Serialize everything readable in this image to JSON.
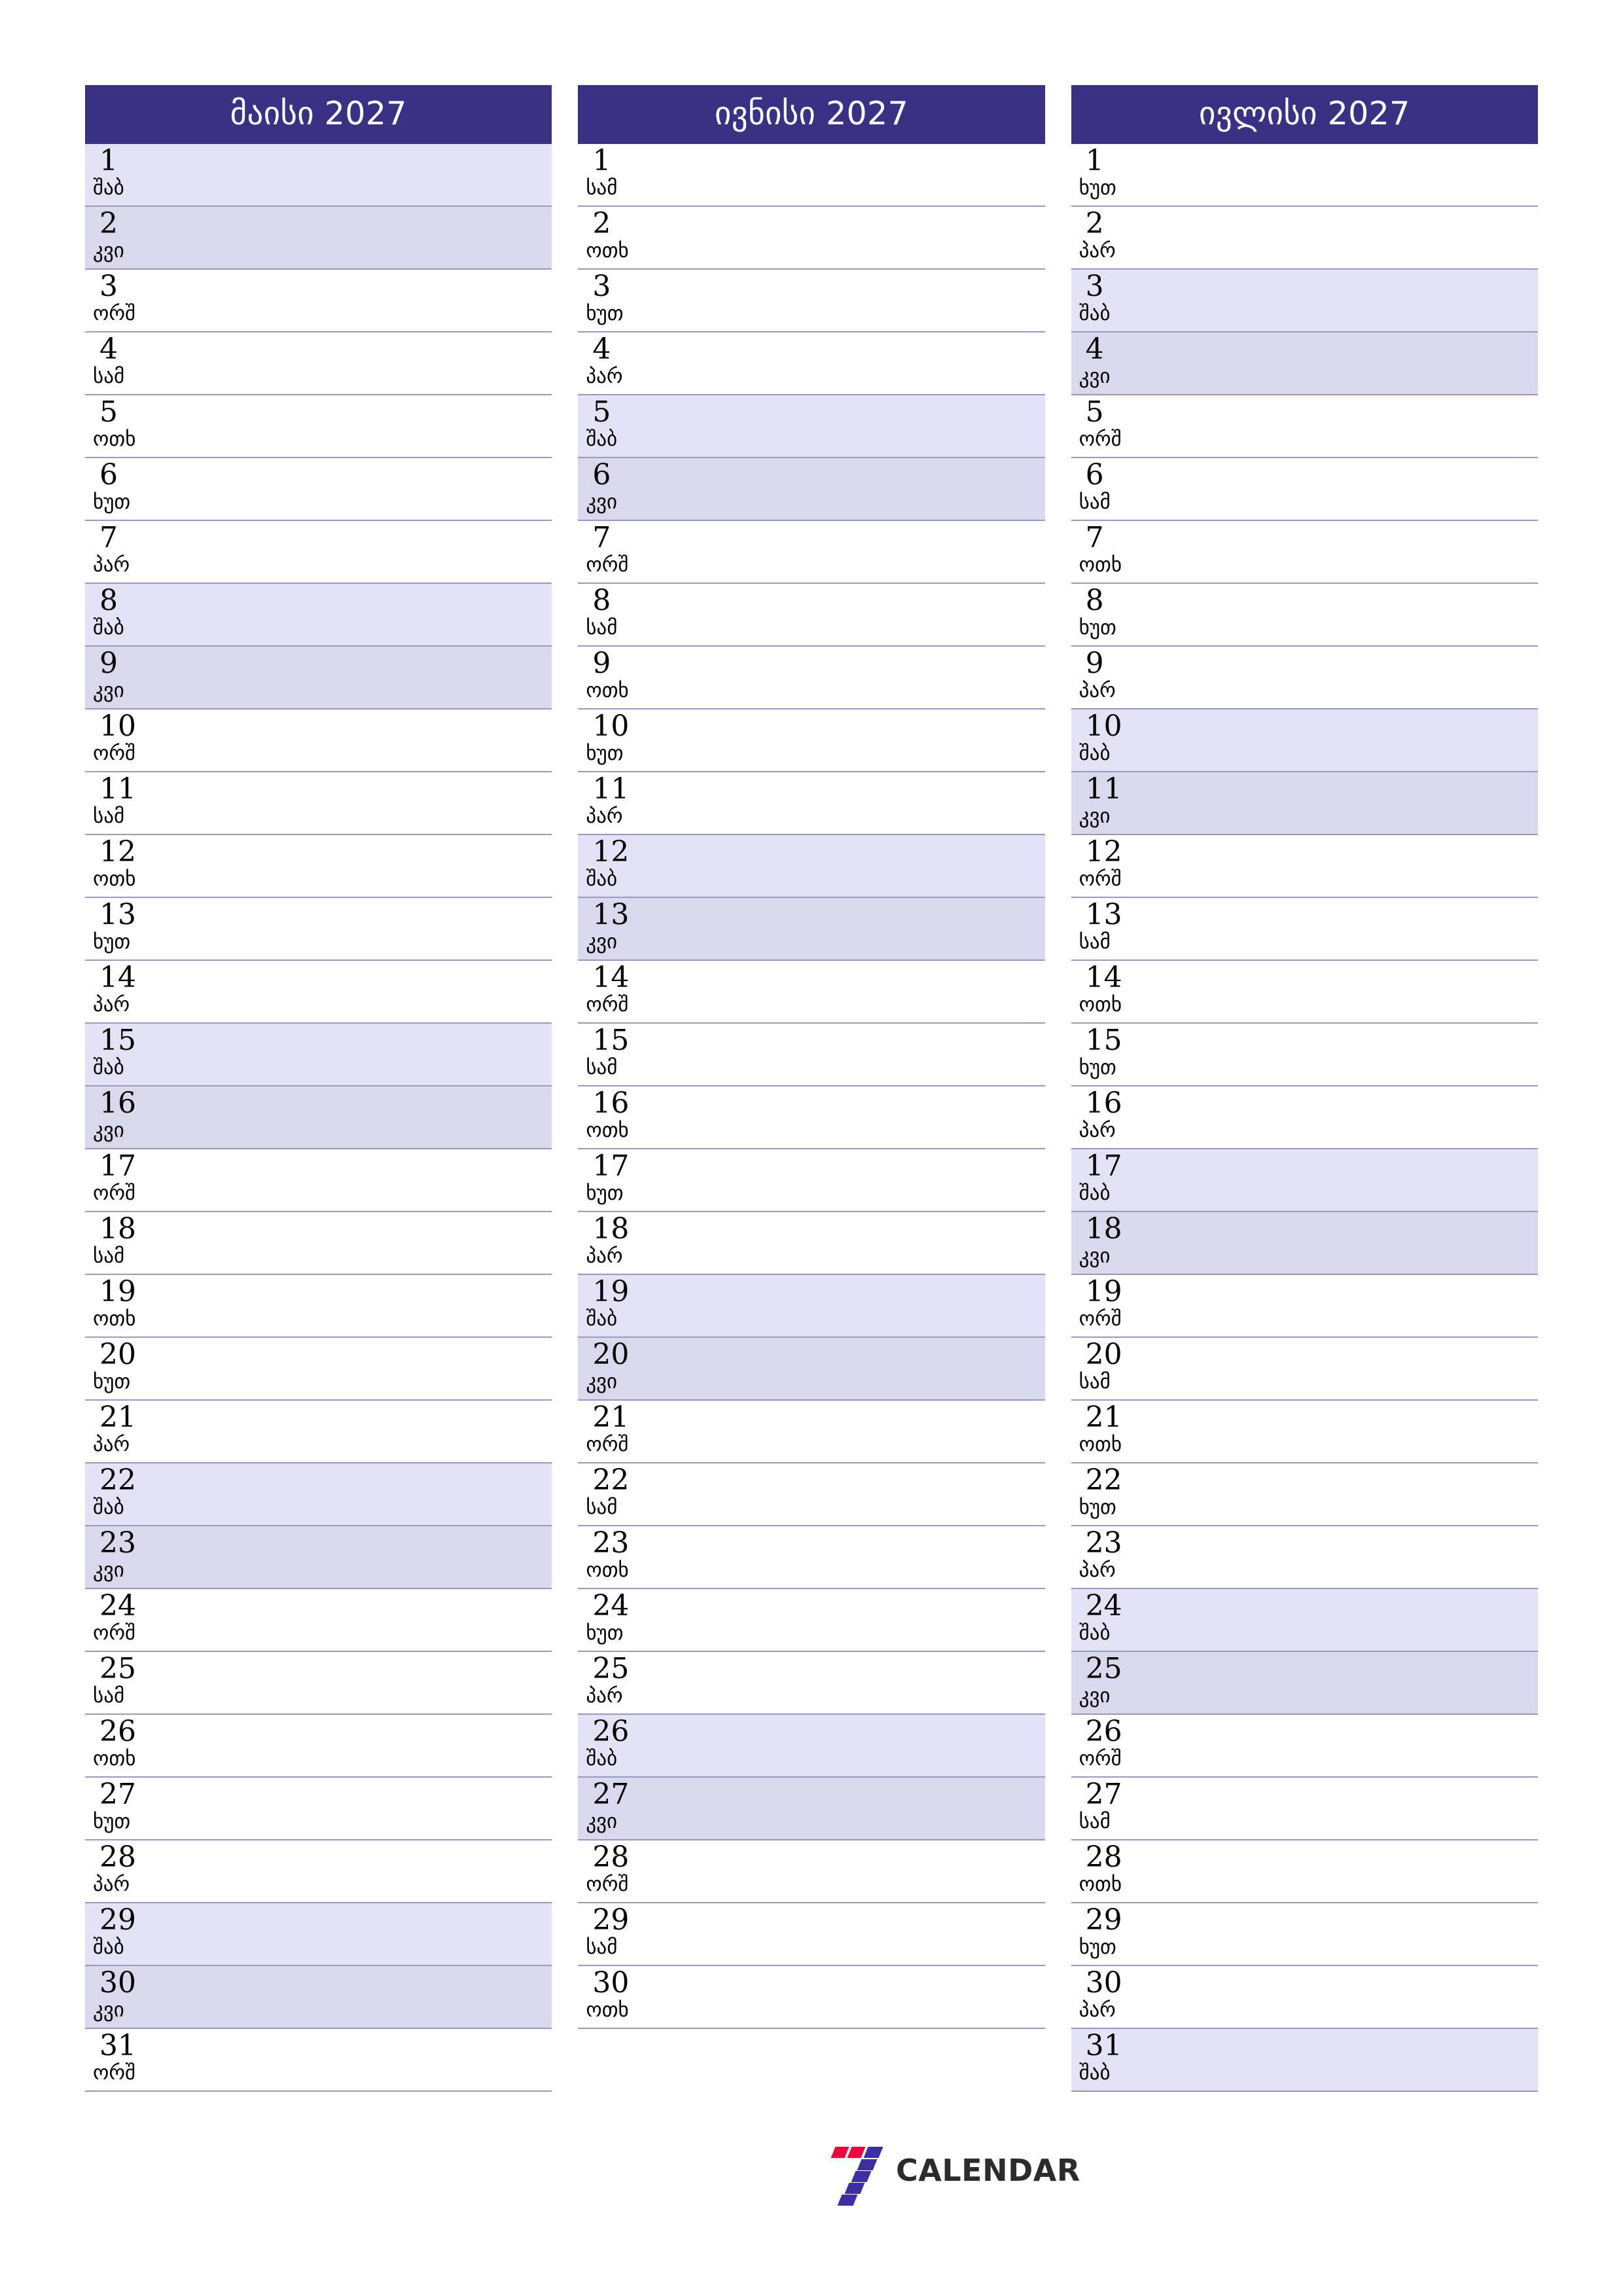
{
  "page": {
    "year": "2027",
    "accent_color": "#3a3185",
    "saturday_color": "#e3e3f5",
    "sunday_color": "#dad8ec",
    "grid_line_color": "#9b96c4"
  },
  "brand": {
    "name": "CALENDAR",
    "mark_colors": [
      "#f4003c",
      "#3d2fa3"
    ]
  },
  "weekday_names": {
    "mon": "ორშ",
    "tue": "სამ",
    "wed": "ოთხ",
    "thu": "ხუთ",
    "fri": "პარ",
    "sat": "შაბ",
    "sun": "კვი"
  },
  "months": [
    {
      "title": "მაისი 2027",
      "name": "მაისი",
      "days": [
        {
          "n": "1",
          "wd": "შაბ",
          "type": "sat"
        },
        {
          "n": "2",
          "wd": "კვი",
          "type": "sun"
        },
        {
          "n": "3",
          "wd": "ორშ",
          "type": "wd"
        },
        {
          "n": "4",
          "wd": "სამ",
          "type": "wd"
        },
        {
          "n": "5",
          "wd": "ოთხ",
          "type": "wd"
        },
        {
          "n": "6",
          "wd": "ხუთ",
          "type": "wd"
        },
        {
          "n": "7",
          "wd": "პარ",
          "type": "wd"
        },
        {
          "n": "8",
          "wd": "შაბ",
          "type": "sat"
        },
        {
          "n": "9",
          "wd": "კვი",
          "type": "sun"
        },
        {
          "n": "10",
          "wd": "ორშ",
          "type": "wd"
        },
        {
          "n": "11",
          "wd": "სამ",
          "type": "wd"
        },
        {
          "n": "12",
          "wd": "ოთხ",
          "type": "wd"
        },
        {
          "n": "13",
          "wd": "ხუთ",
          "type": "wd"
        },
        {
          "n": "14",
          "wd": "პარ",
          "type": "wd"
        },
        {
          "n": "15",
          "wd": "შაბ",
          "type": "sat"
        },
        {
          "n": "16",
          "wd": "კვი",
          "type": "sun"
        },
        {
          "n": "17",
          "wd": "ორშ",
          "type": "wd"
        },
        {
          "n": "18",
          "wd": "სამ",
          "type": "wd"
        },
        {
          "n": "19",
          "wd": "ოთხ",
          "type": "wd"
        },
        {
          "n": "20",
          "wd": "ხუთ",
          "type": "wd"
        },
        {
          "n": "21",
          "wd": "პარ",
          "type": "wd"
        },
        {
          "n": "22",
          "wd": "შაბ",
          "type": "sat"
        },
        {
          "n": "23",
          "wd": "კვი",
          "type": "sun"
        },
        {
          "n": "24",
          "wd": "ორშ",
          "type": "wd"
        },
        {
          "n": "25",
          "wd": "სამ",
          "type": "wd"
        },
        {
          "n": "26",
          "wd": "ოთხ",
          "type": "wd"
        },
        {
          "n": "27",
          "wd": "ხუთ",
          "type": "wd"
        },
        {
          "n": "28",
          "wd": "პარ",
          "type": "wd"
        },
        {
          "n": "29",
          "wd": "შაბ",
          "type": "sat"
        },
        {
          "n": "30",
          "wd": "კვი",
          "type": "sun"
        },
        {
          "n": "31",
          "wd": "ორშ",
          "type": "wd"
        }
      ]
    },
    {
      "title": "ივნისი 2027",
      "name": "ივნისი",
      "days": [
        {
          "n": "1",
          "wd": "სამ",
          "type": "wd"
        },
        {
          "n": "2",
          "wd": "ოთხ",
          "type": "wd"
        },
        {
          "n": "3",
          "wd": "ხუთ",
          "type": "wd"
        },
        {
          "n": "4",
          "wd": "პარ",
          "type": "wd"
        },
        {
          "n": "5",
          "wd": "შაბ",
          "type": "sat"
        },
        {
          "n": "6",
          "wd": "კვი",
          "type": "sun"
        },
        {
          "n": "7",
          "wd": "ორშ",
          "type": "wd"
        },
        {
          "n": "8",
          "wd": "სამ",
          "type": "wd"
        },
        {
          "n": "9",
          "wd": "ოთხ",
          "type": "wd"
        },
        {
          "n": "10",
          "wd": "ხუთ",
          "type": "wd"
        },
        {
          "n": "11",
          "wd": "პარ",
          "type": "wd"
        },
        {
          "n": "12",
          "wd": "შაბ",
          "type": "sat"
        },
        {
          "n": "13",
          "wd": "კვი",
          "type": "sun"
        },
        {
          "n": "14",
          "wd": "ორშ",
          "type": "wd"
        },
        {
          "n": "15",
          "wd": "სამ",
          "type": "wd"
        },
        {
          "n": "16",
          "wd": "ოთხ",
          "type": "wd"
        },
        {
          "n": "17",
          "wd": "ხუთ",
          "type": "wd"
        },
        {
          "n": "18",
          "wd": "პარ",
          "type": "wd"
        },
        {
          "n": "19",
          "wd": "შაბ",
          "type": "sat"
        },
        {
          "n": "20",
          "wd": "კვი",
          "type": "sun"
        },
        {
          "n": "21",
          "wd": "ორშ",
          "type": "wd"
        },
        {
          "n": "22",
          "wd": "სამ",
          "type": "wd"
        },
        {
          "n": "23",
          "wd": "ოთხ",
          "type": "wd"
        },
        {
          "n": "24",
          "wd": "ხუთ",
          "type": "wd"
        },
        {
          "n": "25",
          "wd": "პარ",
          "type": "wd"
        },
        {
          "n": "26",
          "wd": "შაბ",
          "type": "sat"
        },
        {
          "n": "27",
          "wd": "კვი",
          "type": "sun"
        },
        {
          "n": "28",
          "wd": "ორშ",
          "type": "wd"
        },
        {
          "n": "29",
          "wd": "სამ",
          "type": "wd"
        },
        {
          "n": "30",
          "wd": "ოთხ",
          "type": "wd"
        }
      ]
    },
    {
      "title": "ივლისი 2027",
      "name": "ივლისი",
      "days": [
        {
          "n": "1",
          "wd": "ხუთ",
          "type": "wd"
        },
        {
          "n": "2",
          "wd": "პარ",
          "type": "wd"
        },
        {
          "n": "3",
          "wd": "შაბ",
          "type": "sat"
        },
        {
          "n": "4",
          "wd": "კვი",
          "type": "sun"
        },
        {
          "n": "5",
          "wd": "ორშ",
          "type": "wd"
        },
        {
          "n": "6",
          "wd": "სამ",
          "type": "wd"
        },
        {
          "n": "7",
          "wd": "ოთხ",
          "type": "wd"
        },
        {
          "n": "8",
          "wd": "ხუთ",
          "type": "wd"
        },
        {
          "n": "9",
          "wd": "პარ",
          "type": "wd"
        },
        {
          "n": "10",
          "wd": "შაბ",
          "type": "sat"
        },
        {
          "n": "11",
          "wd": "კვი",
          "type": "sun"
        },
        {
          "n": "12",
          "wd": "ორშ",
          "type": "wd"
        },
        {
          "n": "13",
          "wd": "სამ",
          "type": "wd"
        },
        {
          "n": "14",
          "wd": "ოთხ",
          "type": "wd"
        },
        {
          "n": "15",
          "wd": "ხუთ",
          "type": "wd"
        },
        {
          "n": "16",
          "wd": "პარ",
          "type": "wd"
        },
        {
          "n": "17",
          "wd": "შაბ",
          "type": "sat"
        },
        {
          "n": "18",
          "wd": "კვი",
          "type": "sun"
        },
        {
          "n": "19",
          "wd": "ორშ",
          "type": "wd"
        },
        {
          "n": "20",
          "wd": "სამ",
          "type": "wd"
        },
        {
          "n": "21",
          "wd": "ოთხ",
          "type": "wd"
        },
        {
          "n": "22",
          "wd": "ხუთ",
          "type": "wd"
        },
        {
          "n": "23",
          "wd": "პარ",
          "type": "wd"
        },
        {
          "n": "24",
          "wd": "შაბ",
          "type": "sat"
        },
        {
          "n": "25",
          "wd": "კვი",
          "type": "sun"
        },
        {
          "n": "26",
          "wd": "ორშ",
          "type": "wd"
        },
        {
          "n": "27",
          "wd": "სამ",
          "type": "wd"
        },
        {
          "n": "28",
          "wd": "ოთხ",
          "type": "wd"
        },
        {
          "n": "29",
          "wd": "ხუთ",
          "type": "wd"
        },
        {
          "n": "30",
          "wd": "პარ",
          "type": "wd"
        },
        {
          "n": "31",
          "wd": "შაბ",
          "type": "sat"
        }
      ]
    }
  ]
}
